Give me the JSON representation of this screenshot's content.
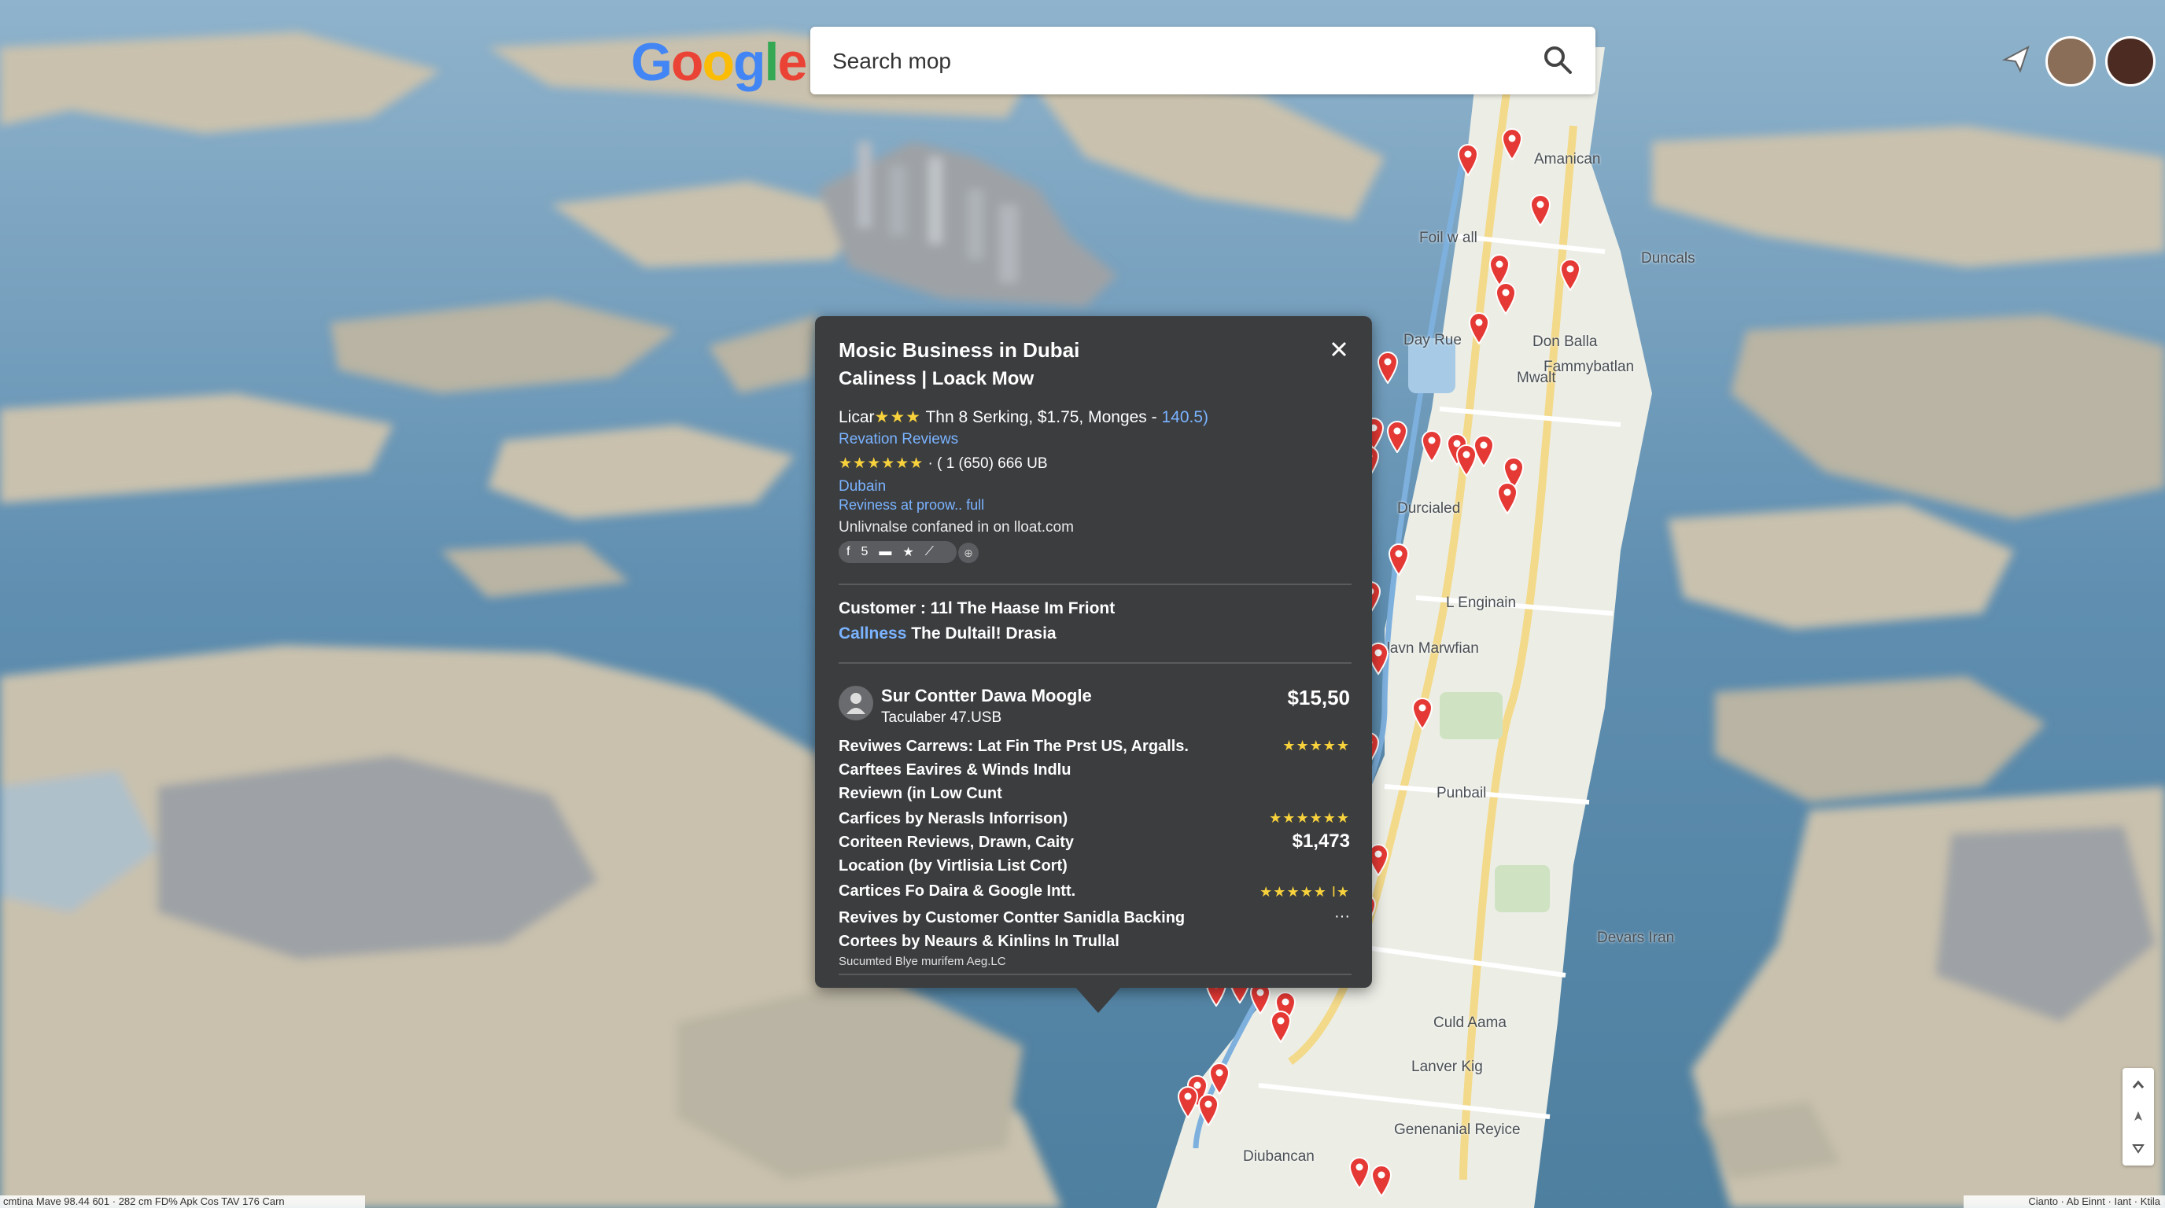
{
  "logo": {
    "letters": [
      "G",
      "o",
      "o",
      "g",
      "l",
      "e"
    ],
    "colors": [
      "#4285F4",
      "#EA4335",
      "#FBBC05",
      "#4285F4",
      "#34A853",
      "#EA4335"
    ]
  },
  "search": {
    "placeholder": "Search mop"
  },
  "icons": {
    "search": "search-icon",
    "share": "share-icon",
    "close": "close-icon"
  },
  "map_labels": [
    "Amanican",
    "Foil w all",
    "Duncals",
    "Day Rue",
    "Don Balla",
    "Fammybatlan",
    "Mwalt",
    "Durcialed",
    "L Enginain",
    "Llavn Marwfian",
    "Punbail",
    "Devars Iran",
    "Culd Aama",
    "Lanver Kig",
    "Genenanial Reyice",
    "Diubancan"
  ],
  "popup": {
    "title": "Mosic Business in Dubai",
    "subtitle": "Caliness | Loack Mow",
    "rating_line": {
      "prefix": "Licar",
      "stars": "★★★",
      "text": " Thn 8 Serking, $1.75, Monges - ",
      "value": "140.5)"
    },
    "reviews_link": "Revation Reviews",
    "stars_line": {
      "stars": "★★★★★★",
      "text": "· ( 1 (650) 666 UB"
    },
    "location_link": "Dubain",
    "preview_link": "Reviness at proow.. full",
    "info_text": "Unlivnalse confaned in on lloat.com",
    "chip_glyphs": [
      "f",
      "5",
      "▬",
      "★",
      "⟋"
    ],
    "chip_more": "⊕",
    "customer_line": "Customer : 11l The Haase Im Friont",
    "callness_label": "Callness",
    "callness_text": " The Dultail! Drasia",
    "business": {
      "name": "Sur Contter Dawa Moogle",
      "sub": "Taculaber 47.USB",
      "price": "$15,50"
    },
    "rows": [
      {
        "text": "Reviwes Carrews: Lat Fin The Prst US, Argalls.",
        "right": "★★★★★"
      },
      {
        "text": "Carftees Eavires & Winds Indlu",
        "right": ""
      },
      {
        "text": "Reviewn (in Low Cunt",
        "right": ""
      },
      {
        "text": "Carfices by Nerasls Inforrison)",
        "right": "★★★★★★"
      },
      {
        "text": "Coriteen Reviews, Drawn, Caity",
        "right": "$1,473"
      },
      {
        "text": "Location (by Virtlisia List Cort)",
        "right": ""
      },
      {
        "text": "Cartices Fo Daira & Google Intt.",
        "right": "★★★★★ I★"
      },
      {
        "text": "Revives by Customer Contter Sanidla Backing",
        "right": "···"
      },
      {
        "text": "Cortees by Neaurs & Kinlins In Trullal",
        "right": ""
      }
    ],
    "footer": "Sucumted Blye murifem Aeg.LC"
  },
  "status_bar": "cmtina Mave 98.44 601 · 282 cm FD% Apk Cos TAV 176 Carn",
  "attribution": "Cianto · Ab Einnt · Iant · Ktila"
}
